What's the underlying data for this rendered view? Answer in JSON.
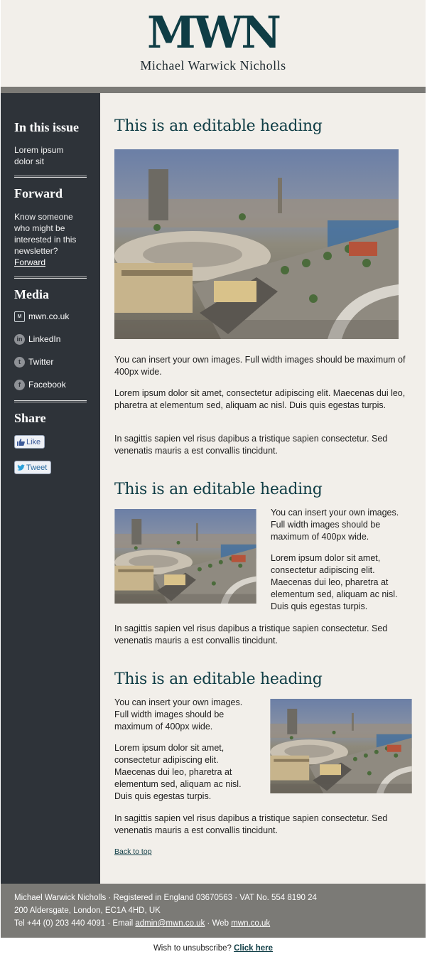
{
  "header": {
    "logo": "MWN",
    "name": "Michael Warwick Nicholls"
  },
  "sidebar": {
    "issue": {
      "heading": "In this issue",
      "text": "Lorem ipsum dolor sit"
    },
    "forward": {
      "heading": "Forward",
      "text": "Know someone who might be interested in this newsletter?",
      "link": "Forward"
    },
    "media": {
      "heading": "Media",
      "items": [
        {
          "label": "mwn.co.uk",
          "icon": "mwn-icon"
        },
        {
          "label": "LinkedIn",
          "icon": "linkedin-icon"
        },
        {
          "label": "Twitter",
          "icon": "twitter-icon"
        },
        {
          "label": "Facebook",
          "icon": "facebook-icon"
        }
      ]
    },
    "share": {
      "heading": "Share",
      "like": "Like",
      "tweet": "Tweet"
    }
  },
  "articles": [
    {
      "heading": "This is an editable heading",
      "p1": "You can insert your own images. Full width images should be maximum of 400px wide.",
      "p2": "Lorem ipsum dolor sit amet, consectetur adipiscing elit. Maecenas dui leo, pharetra at elementum sed, aliquam ac nisl. Duis quis egestas turpis.",
      "p3": "In sagittis sapien vel risus dapibus a tristique sapien consectetur. Sed venenatis mauris a est convallis tincidunt."
    },
    {
      "heading": "This is an editable heading",
      "p1": "You can insert your own images. Full width images should be maximum of 400px wide.",
      "p2": "Lorem ipsum dolor sit amet, consectetur adipiscing elit. Maecenas dui leo, pharetra at elementum sed, aliquam ac nisl. Duis quis egestas turpis.",
      "p3": "In sagittis sapien vel risus dapibus a tristique sapien consectetur. Sed venenatis mauris a est convallis tincidunt."
    },
    {
      "heading": "This is an editable heading",
      "p1": "You can insert your own images. Full width images should be maximum of 400px wide.",
      "p2": "Lorem ipsum dolor sit amet, consectetur adipiscing elit. Maecenas dui leo, pharetra at elementum sed, aliquam ac nisl. Duis quis egestas turpis.",
      "p3": "In sagittis sapien vel risus dapibus a tristique sapien consectetur. Sed venenatis mauris a est convallis tincidunt."
    }
  ],
  "back_to_top": "Back to top",
  "footer": {
    "line1": "Michael Warwick Nicholls · Registered in England 03670563 · VAT No. 554 8190 24",
    "line2": "200 Aldersgate, London, EC1A 4HD, UK",
    "tel": "Tel +44 (0) 203 440 4091 · Email ",
    "email": "admin@mwn.co.uk",
    "web_sep": " · Web ",
    "web": "mwn.co.uk"
  },
  "unsubscribe": {
    "text": "Wish to unsubscribe? ",
    "link": "Click here"
  },
  "colors": {
    "heading": "#0f3d45",
    "sidebar": "#2e3339",
    "footer": "#7b7a76",
    "page": "#f2efea"
  }
}
